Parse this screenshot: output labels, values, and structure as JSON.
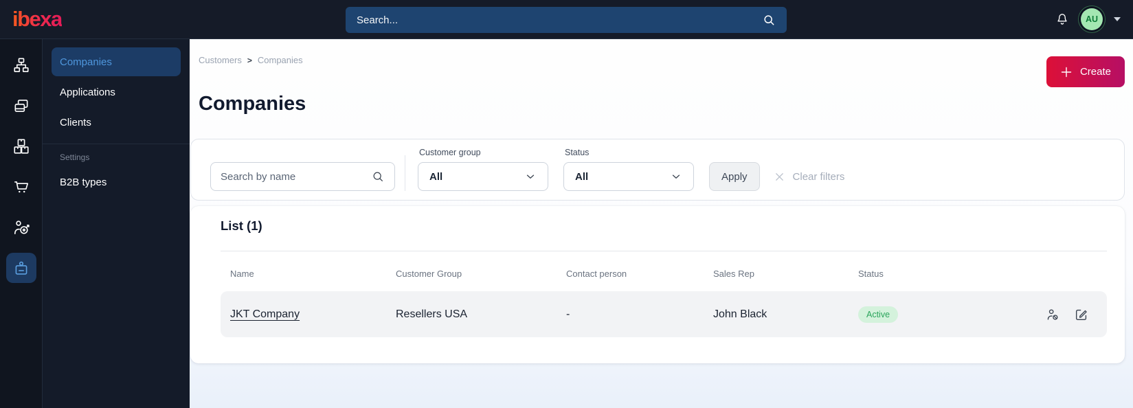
{
  "topbar": {
    "logo_text": "ibexa",
    "search_placeholder": "Search...",
    "user_initials": "AU",
    "icons": [
      "bell-icon",
      "search-icon",
      "chevron-down-icon"
    ]
  },
  "sidebar": {
    "rail_icons": [
      "sitemap-icon",
      "pages-icon",
      "products-boxes-icon",
      "cart-icon",
      "audience-target-icon",
      "company-badge-icon"
    ],
    "rail_active_index": 5,
    "menu_items": [
      {
        "label": "Companies",
        "active": true
      },
      {
        "label": "Applications",
        "active": false
      },
      {
        "label": "Clients",
        "active": false
      }
    ],
    "settings_label": "Settings",
    "settings_items": [
      {
        "label": "B2B types"
      }
    ]
  },
  "main": {
    "breadcrumb": [
      "Customers",
      "Companies"
    ],
    "create_label": "Create",
    "title": "Companies",
    "filters": {
      "search_placeholder": "Search by name",
      "groups": [
        {
          "label": "Customer group",
          "value": "All"
        },
        {
          "label": "Status",
          "value": "All"
        }
      ],
      "apply_label": "Apply",
      "clear_label": "Clear filters"
    },
    "list": {
      "title": "List (1)",
      "columns": [
        "Name",
        "Customer Group",
        "Contact person",
        "Sales Rep",
        "Status"
      ],
      "rows": [
        {
          "name": "JKT Company",
          "customer_group": "Resellers USA",
          "contact_person": "-",
          "sales_rep": "John Black",
          "status": "Active"
        }
      ],
      "row_action_icons": [
        "deactivate-user-icon",
        "edit-icon"
      ]
    }
  },
  "colors": {
    "topbar_bg": "#151b28",
    "rail_bg": "#10151f",
    "panel_bg": "#141b29",
    "active_item_bg": "#1c3c66",
    "active_item_text": "#4f97dd",
    "brand_gradient": [
      "#f4591f",
      "#e31b58"
    ],
    "create_gradient": [
      "#dc1038",
      "#b60f64"
    ],
    "status_active_bg": "#d4f2dc",
    "status_active_text": "#2aa45b",
    "avatar_bg": "#a4e7b2",
    "row_bg": "#f2f3f5"
  }
}
